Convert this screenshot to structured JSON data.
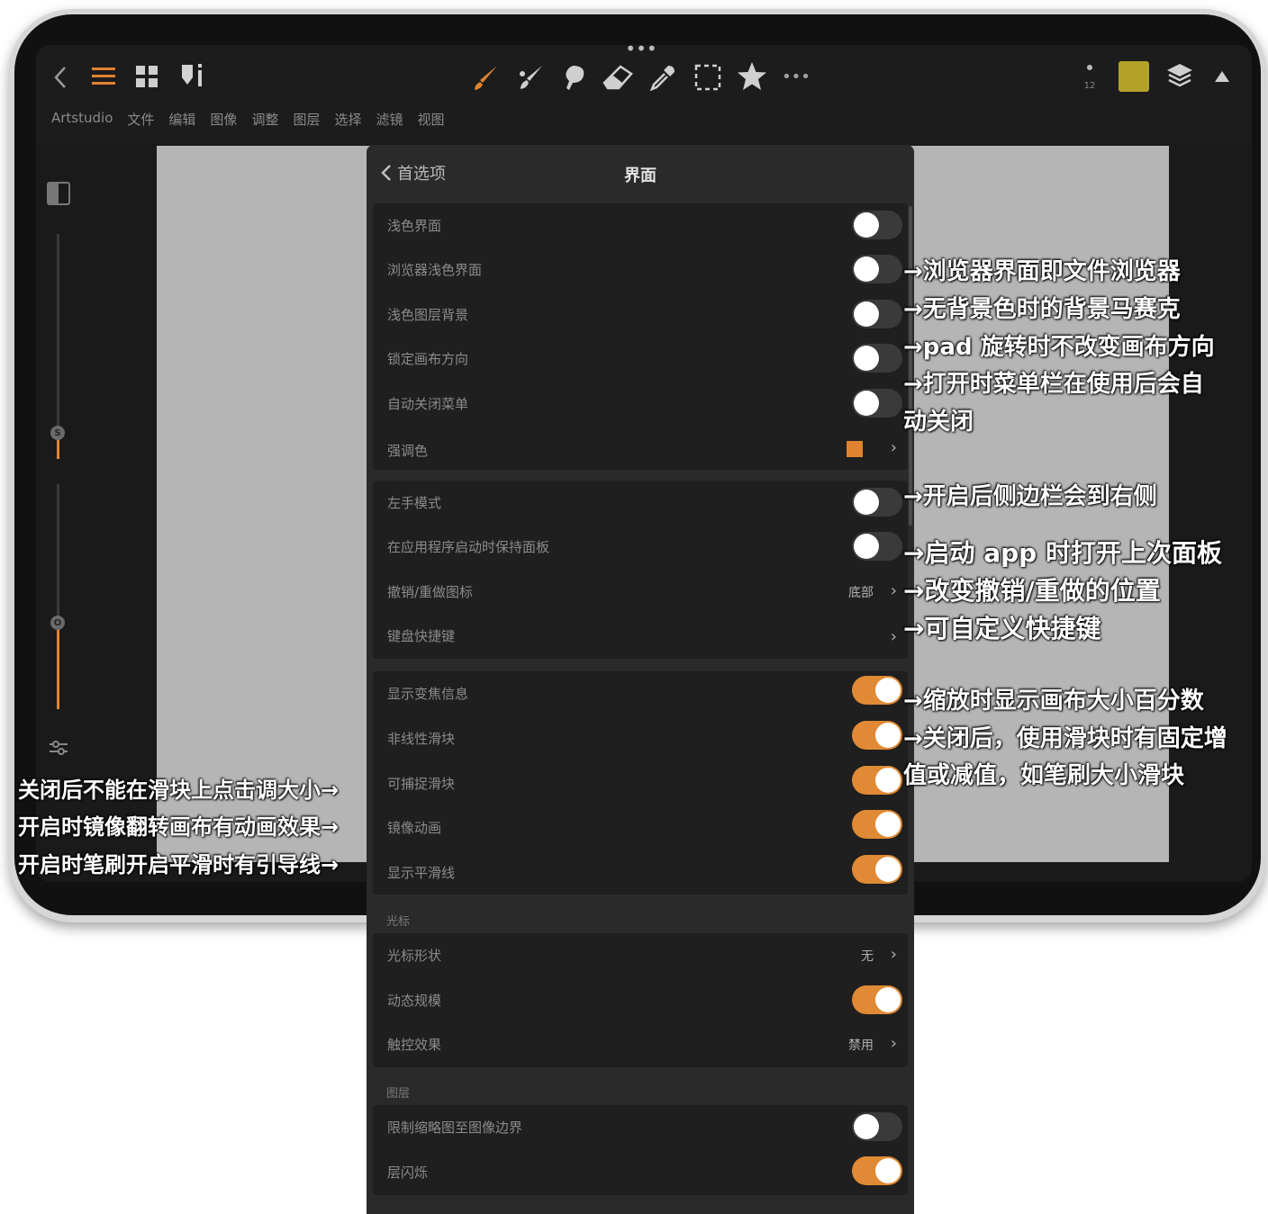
{
  "menubar": {
    "items": [
      "Artstudio",
      "文件",
      "编辑",
      "图像",
      "调整",
      "图层",
      "选择",
      "滤镜",
      "视图"
    ]
  },
  "toolbar": {
    "size_value": "12",
    "color": "#b3a22a",
    "tools": [
      "back-icon",
      "menu-icon",
      "grid-icon",
      "brush-settings-icon",
      "brush-icon",
      "smudge-icon",
      "blend-icon",
      "eraser-icon",
      "eyedropper-icon",
      "selection-icon",
      "star-icon",
      "more-icon",
      "layers-icon",
      "up-arrow-icon"
    ]
  },
  "left_panel": {
    "size_knob": "S",
    "opacity_knob": "O"
  },
  "panel": {
    "back_label": "首选项",
    "title": "界面",
    "groups": [
      {
        "rows": [
          {
            "label": "浅色界面",
            "type": "toggle",
            "on": false
          },
          {
            "label": "浏览器浅色界面",
            "type": "toggle",
            "on": false
          },
          {
            "label": "浅色图层背景",
            "type": "toggle",
            "on": false
          },
          {
            "label": "锁定画布方向",
            "type": "toggle",
            "on": false
          },
          {
            "label": "自动关闭菜单",
            "type": "toggle",
            "on": false
          },
          {
            "label": "强调色",
            "type": "color",
            "color": "#e0832f"
          }
        ]
      },
      {
        "rows": [
          {
            "label": "左手模式",
            "type": "toggle",
            "on": false
          },
          {
            "label": "在应用程序启动时保持面板",
            "type": "toggle",
            "on": false
          },
          {
            "label": "撤销/重做图标",
            "type": "select",
            "value": "底部"
          },
          {
            "label": "键盘快捷键",
            "type": "link"
          }
        ]
      },
      {
        "rows": [
          {
            "label": "显示变焦信息",
            "type": "toggle",
            "on": true
          },
          {
            "label": "非线性滑块",
            "type": "toggle",
            "on": true
          },
          {
            "label": "可捕捉滑块",
            "type": "toggle",
            "on": true
          },
          {
            "label": "镜像动画",
            "type": "toggle",
            "on": true
          },
          {
            "label": "显示平滑线",
            "type": "toggle",
            "on": true
          }
        ]
      },
      {
        "section": "光标",
        "rows": [
          {
            "label": "光标形状",
            "type": "select",
            "value": "无"
          },
          {
            "label": "动态规模",
            "type": "toggle",
            "on": true
          },
          {
            "label": "触控效果",
            "type": "select",
            "value": "禁用"
          }
        ]
      },
      {
        "section": "图层",
        "rows": [
          {
            "label": "限制缩略图至图像边界",
            "type": "toggle",
            "on": false
          },
          {
            "label": "层闪烁",
            "type": "toggle",
            "on": true
          }
        ]
      }
    ]
  },
  "annotations": {
    "right": [
      "→浏览器界面即文件浏览器",
      "→无背景色时的背景马赛克",
      "→pad 旋转时不改变画布方向",
      "→打开时菜单栏在使用后会自",
      "动关闭",
      "→开启后侧边栏会到右侧",
      "→启动 app 时打开上次面板",
      "→改变撤销/重做的位置",
      "→可自定义快捷键",
      "→缩放时显示画布大小百分数",
      "→关闭后，使用滑块时有固定增",
      "值或减值，如笔刷大小滑块"
    ],
    "left": [
      "关闭后不能在滑块上点击调大小→",
      "开启时镜像翻转画布有动画效果→",
      "开启时笔刷开启平滑时有引导线→"
    ]
  },
  "colors": {
    "accent": "#e0832f",
    "toggle_on": "#e08a35",
    "panel_bg": "#2a2a2a",
    "group_bg": "#1f1f1f"
  }
}
